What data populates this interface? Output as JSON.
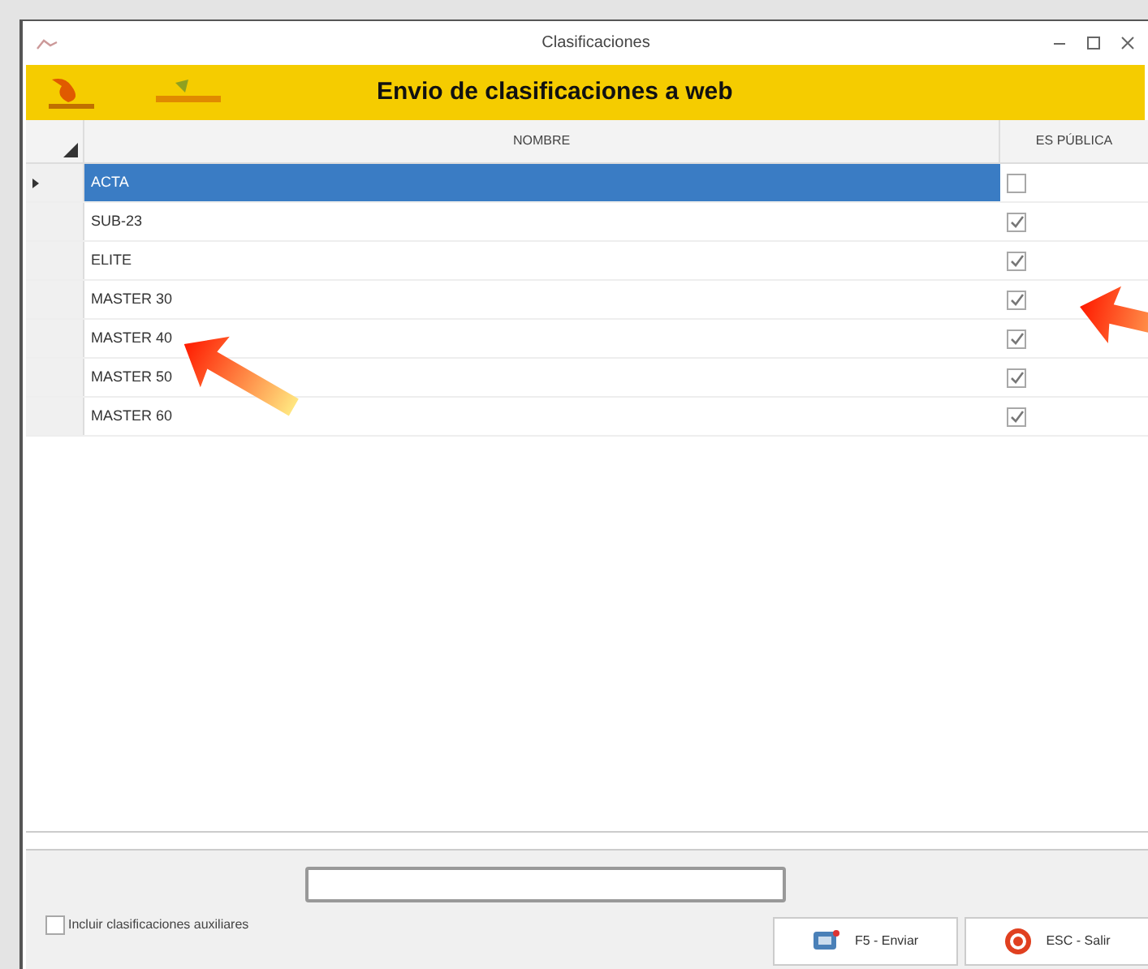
{
  "window": {
    "title": "Clasificaciones"
  },
  "banner": {
    "title": "Envio de clasificaciones a web"
  },
  "table": {
    "columns": [
      "NOMBRE",
      "ES PÚBLICA"
    ],
    "rows": [
      {
        "nombre": "ACTA",
        "es_publica": false,
        "selected": true
      },
      {
        "nombre": "SUB-23",
        "es_publica": true,
        "selected": false
      },
      {
        "nombre": "ELITE",
        "es_publica": true,
        "selected": false
      },
      {
        "nombre": "MASTER 30",
        "es_publica": true,
        "selected": false
      },
      {
        "nombre": "MASTER 40",
        "es_publica": true,
        "selected": false
      },
      {
        "nombre": "MASTER 50",
        "es_publica": true,
        "selected": false
      },
      {
        "nombre": "MASTER 60",
        "es_publica": true,
        "selected": false
      }
    ]
  },
  "footer": {
    "checkbox": {
      "label": "Incluir clasificaciones auxiliares",
      "checked": false
    },
    "buttons": [
      {
        "kind": "send",
        "label": "F5 - Enviar"
      },
      {
        "kind": "exit",
        "label": "ESC - Salir"
      }
    ]
  }
}
